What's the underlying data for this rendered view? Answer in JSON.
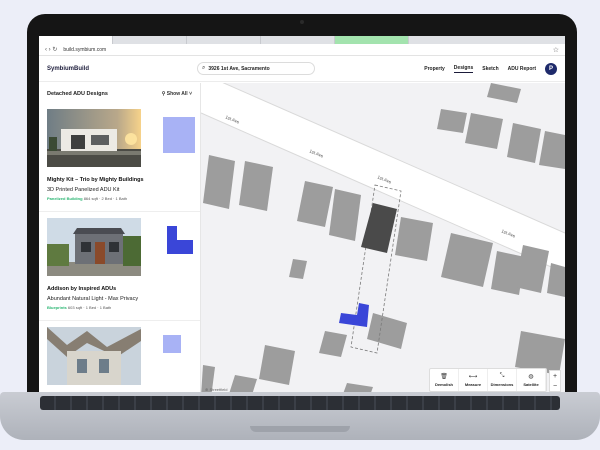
{
  "browser": {
    "url": "build.symbium.com",
    "nav_icons": "‹ › ↻"
  },
  "header": {
    "logo": "SymbiumBuild",
    "search_value": "3926 1st Ave, Sacramento",
    "nav": [
      "Property",
      "Designs",
      "Sketch",
      "ADU Report"
    ],
    "active_nav": "Designs",
    "avatar_initial": "P"
  },
  "sidebar": {
    "title": "Detached ADU Designs",
    "show_all": "Show All",
    "cards": [
      {
        "name": "Mighty Kit – Trio by Mighty Buildings",
        "subtitle": "3D Printed Panelized ADU Kit",
        "tag": "Panelized Building",
        "meta": "864 sqft · 2 Bed · 1 Bath"
      },
      {
        "name": "Addison by Inspired ADUs",
        "subtitle": "Abundant Natural Light - Max Privacy",
        "tag": "Blueprints",
        "meta": "603 sqft · 1 Bed · 1 Bath"
      },
      {
        "name": "",
        "subtitle": "",
        "tag": "",
        "meta": ""
      }
    ]
  },
  "map": {
    "road_labels": [
      "1st Ave",
      "1st Ave",
      "1st Ave",
      "1st Ave"
    ],
    "attribution": "Streetfield",
    "tools": [
      {
        "label": "Demolish",
        "icon": "trash-icon"
      },
      {
        "label": "Measure",
        "icon": "ruler-icon"
      },
      {
        "label": "Dimensions",
        "icon": "dimensions-icon"
      },
      {
        "label": "Satellite",
        "icon": "globe-icon"
      }
    ],
    "zoom_in": "+",
    "zoom_out": "−"
  },
  "colors": {
    "accent": "#3a46d8",
    "plan": "#a8b2f5",
    "building": "#9d9d9d",
    "tag_green": "#2bb673"
  }
}
